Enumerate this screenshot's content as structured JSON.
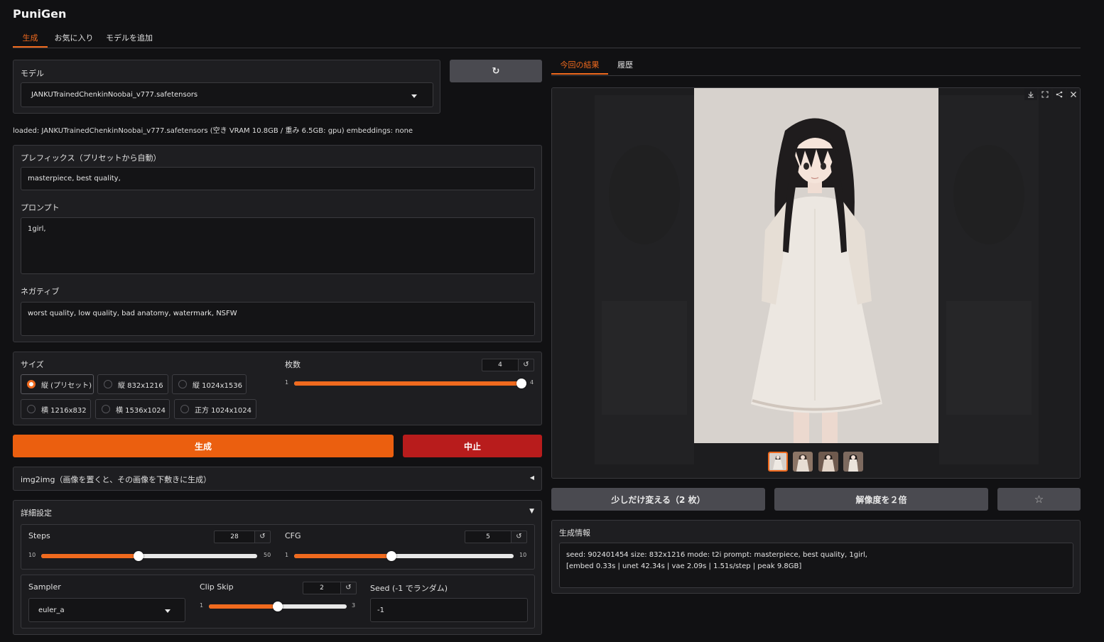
{
  "app": {
    "title": "PuniGen"
  },
  "tabs": [
    {
      "label": "生成",
      "active": true
    },
    {
      "label": "お気に入り"
    },
    {
      "label": "モデルを追加"
    }
  ],
  "model": {
    "label": "モデル",
    "selected": "JANKUTrainedChenkinNoobai_v777.safetensors",
    "refresh_icon": "↻",
    "status": "loaded: JANKUTrainedChenkinNoobai_v777.safetensors (空き VRAM 10.8GB / 重み 6.5GB: gpu) embeddings: none"
  },
  "prompts": {
    "prefix_label": "プレフィックス（プリセットから自動）",
    "prefix_value": "masterpiece, best quality,",
    "prompt_label": "プロンプト",
    "prompt_value": "1girl,",
    "negative_label": "ネガティブ",
    "negative_value": "worst quality, low quality, bad anatomy, watermark, NSFW"
  },
  "size": {
    "label": "サイズ",
    "options": [
      {
        "label": "縦 (プリセット)",
        "selected": true
      },
      {
        "label": "縦 832x1216"
      },
      {
        "label": "縦 1024x1536"
      },
      {
        "label": "横 1216x832"
      },
      {
        "label": "横 1536x1024"
      },
      {
        "label": "正方 1024x1024"
      }
    ]
  },
  "count": {
    "label": "枚数",
    "value": "4",
    "min": "1",
    "max": "4",
    "fraction": 1.0,
    "reset_icon": "↺"
  },
  "actions": {
    "generate": "生成",
    "stop": "中止"
  },
  "img2img": {
    "label": "img2img（画像を置くと、その画像を下敷きに生成）",
    "caret": "◀"
  },
  "advanced": {
    "label": "詳細設定",
    "caret": "▼",
    "steps": {
      "label": "Steps",
      "value": "28",
      "min": "10",
      "max": "50",
      "fraction": 0.45
    },
    "cfg": {
      "label": "CFG",
      "value": "5",
      "min": "1",
      "max": "10",
      "fraction": 0.444
    },
    "sampler": {
      "label": "Sampler",
      "value": "euler_a"
    },
    "clip_skip": {
      "label": "Clip Skip",
      "value": "2",
      "min": "1",
      "max": "3",
      "fraction": 0.5
    },
    "seed": {
      "label": "Seed (-1 でランダム)",
      "value": "-1"
    }
  },
  "results": {
    "tabs": [
      {
        "label": "今回の結果",
        "active": true
      },
      {
        "label": "履歴"
      }
    ],
    "tools": {
      "download": "download-icon",
      "fullscreen": "fullscreen-icon",
      "share": "share-icon",
      "close": "close-icon"
    },
    "thumbnails": 4
  },
  "result_actions": {
    "variation": "少しだけ変える（2 枚）",
    "upscale": "解像度を２倍",
    "favorite_icon": "☆"
  },
  "info": {
    "label": "生成情報",
    "line1": "seed: 902401454  size: 832x1216  mode: t2i  prompt: masterpiece, best quality, 1girl,",
    "line2": "[embed 0.33s | unet 42.34s | vae 2.09s | 1.51s/step | peak 9.8GB]"
  },
  "colors": {
    "accent": "#f06a1e",
    "stop": "#b81c1c",
    "background": "#111113",
    "panel": "#1e1e21"
  }
}
